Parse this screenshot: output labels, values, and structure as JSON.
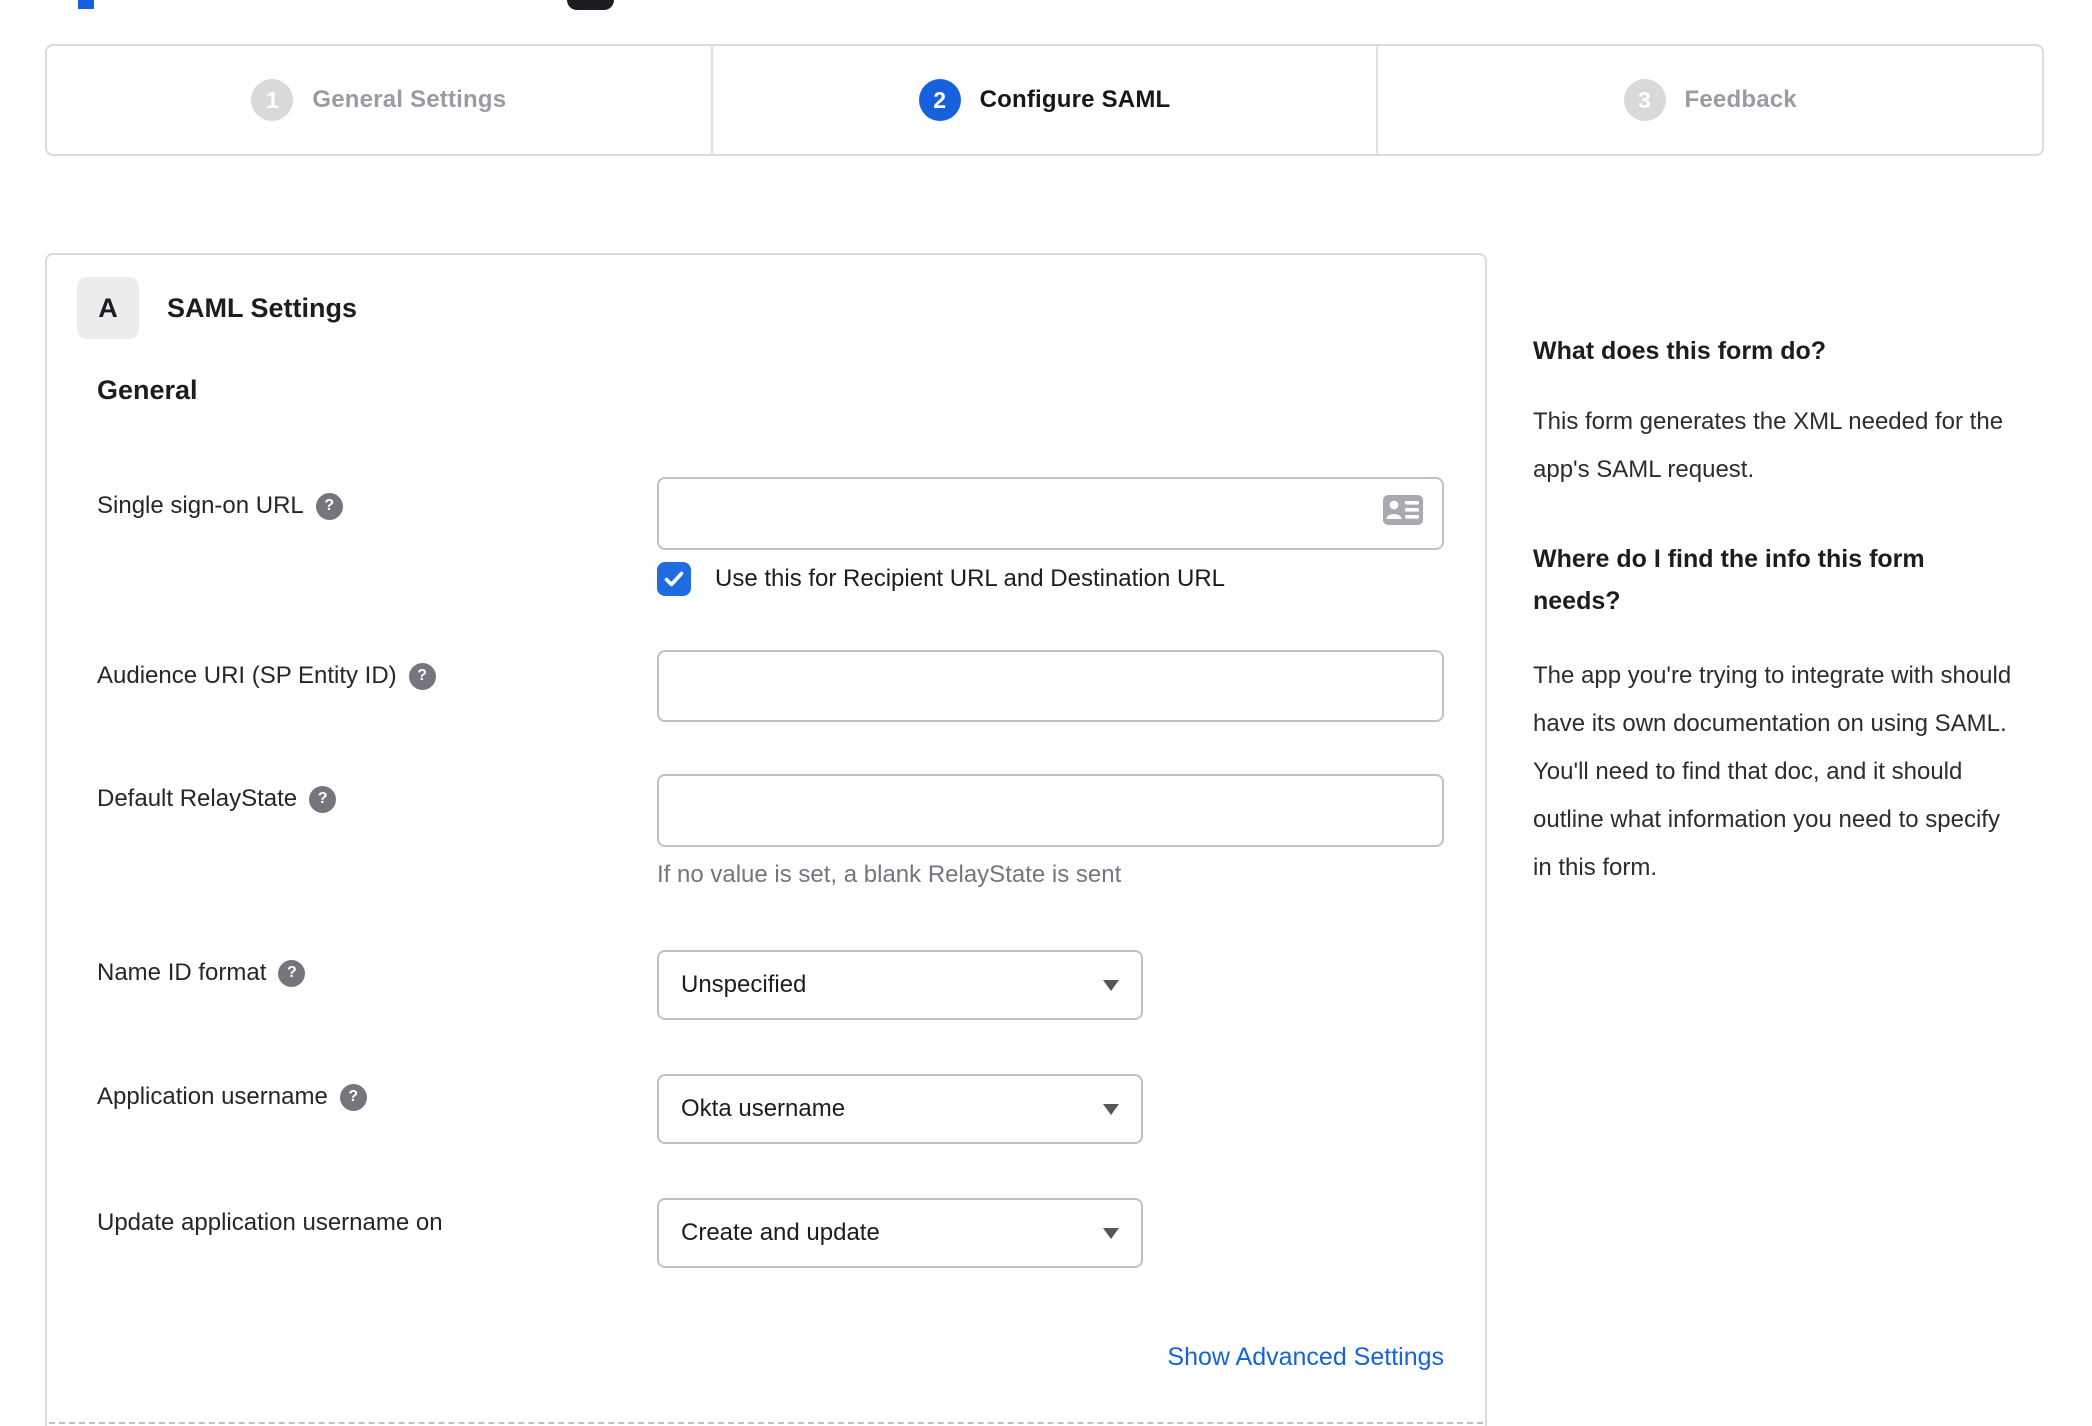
{
  "stepper": {
    "steps": [
      {
        "number": "1",
        "label": "General Settings",
        "active": false
      },
      {
        "number": "2",
        "label": "Configure SAML",
        "active": true
      },
      {
        "number": "3",
        "label": "Feedback",
        "active": false
      }
    ]
  },
  "panel": {
    "badge": "A",
    "title": "SAML Settings",
    "section": "General",
    "fields": {
      "sso": {
        "label": "Single sign-on URL",
        "value": "",
        "checkbox_label": "Use this for Recipient URL and Destination URL",
        "checkbox_checked": true
      },
      "audience": {
        "label": "Audience URI (SP Entity ID)",
        "value": ""
      },
      "relay": {
        "label": "Default RelayState",
        "value": "",
        "helper": "If no value is set, a blank RelayState is sent"
      },
      "nameid": {
        "label": "Name ID format",
        "value": "Unspecified"
      },
      "appuser": {
        "label": "Application username",
        "value": "Okta username"
      },
      "updateuser": {
        "label": "Update application username on",
        "value": "Create and update"
      }
    },
    "advanced_link": "Show Advanced Settings"
  },
  "sidebar": {
    "q1": "What does this form do?",
    "a1": "This form generates the XML needed for the app's SAML request.",
    "q2": "Where do I find the info this form needs?",
    "a2": "The app you're trying to integrate with should have its own documentation on using SAML. You'll need to find that doc, and it should outline what information you need to specify in this form."
  },
  "icons": {
    "help": "question-mark-icon",
    "sso_input": "contact-card-icon",
    "checkbox": "checkmark-icon",
    "select": "caret-down-icon"
  },
  "colors": {
    "accent_blue": "#1662dd",
    "checkbox_blue": "#1f6ce1",
    "inactive_circle_gray": "#d9d9dc",
    "inactive_text_gray": "#9b9ba1",
    "border_gray": "#dadbdd",
    "input_border_gray": "#bfc1c4",
    "helper_gray": "#75757d"
  }
}
